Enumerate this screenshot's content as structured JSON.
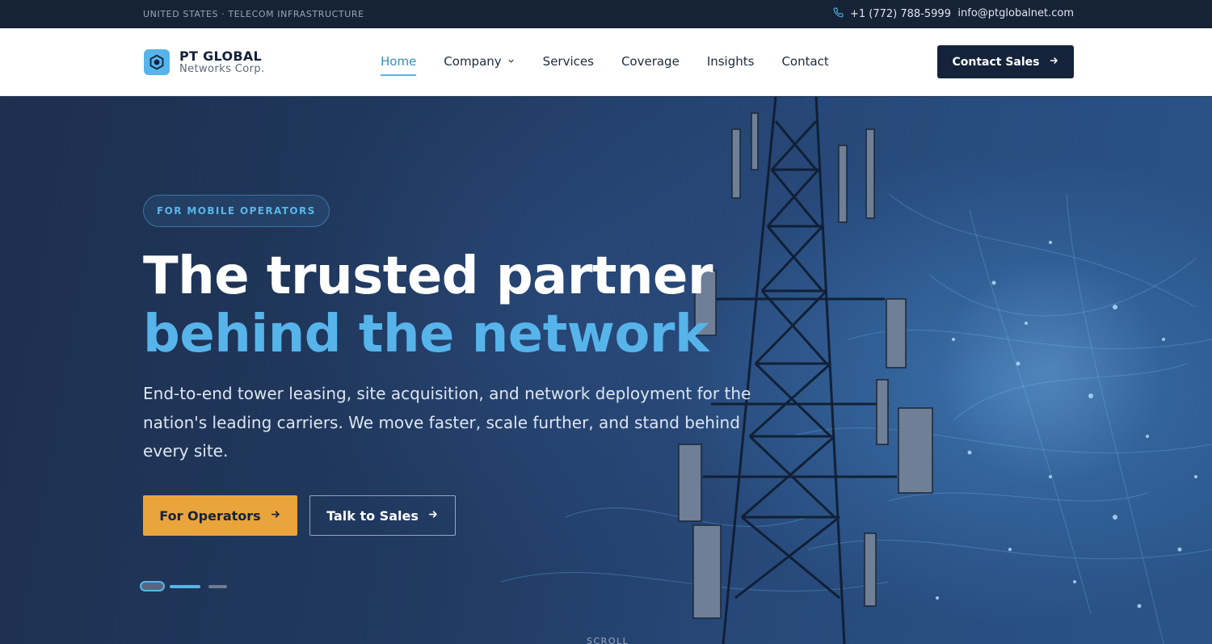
{
  "topbar": {
    "region": "UNITED STATES · TELECOM INFRASTRUCTURE",
    "phone": "+1 (772) 788-5999",
    "email": "info@ptglobalnet.com"
  },
  "logo": {
    "name": "PT GLOBAL",
    "subname": "Networks Corp."
  },
  "nav": {
    "items": [
      {
        "label": "Home",
        "active": true
      },
      {
        "label": "Company",
        "has_dropdown": true
      },
      {
        "label": "Services"
      },
      {
        "label": "Coverage"
      },
      {
        "label": "Insights"
      },
      {
        "label": "Contact"
      }
    ],
    "cta": "Contact Sales"
  },
  "hero": {
    "badge": "FOR MOBILE OPERATORS",
    "headline_line1": "The trusted partner",
    "headline_line2": "behind the network",
    "lead": "End-to-end tower leasing, site acquisition, and network deployment for the nation's leading carriers. We move faster, scale further, and stand behind every site.",
    "primary_button": "For Operators",
    "secondary_button": "Talk to Sales",
    "slides": 3,
    "active_slide": 1,
    "scroll_label": "SCROLL"
  },
  "colors": {
    "accent": "#57b4ea",
    "navy": "#14223a",
    "orange": "#e9a43c"
  },
  "icons": [
    "phone-icon",
    "logo-hexagon-icon",
    "chevron-down-icon",
    "arrow-right-icon"
  ]
}
